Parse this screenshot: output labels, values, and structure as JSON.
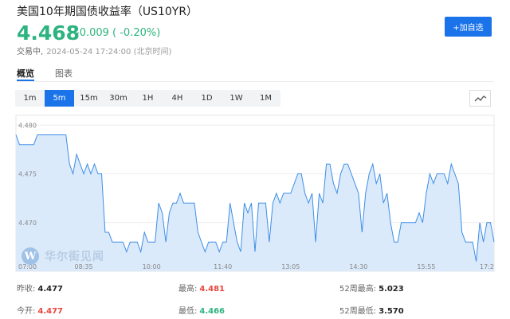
{
  "header": {
    "title": "美国10年期国债收益率（US10YR）",
    "price": "4.468",
    "change": "-0.009 ( -0.20%)",
    "status": "交易中,",
    "timestamp": "2024-05-24 17:24:00 (北京时间)",
    "add_label": "+加自选"
  },
  "view_tabs": [
    "概览",
    "图表"
  ],
  "intervals": [
    "1m",
    "5m",
    "15m",
    "30m",
    "1H",
    "4H",
    "1D",
    "1W",
    "1M"
  ],
  "active_interval": "5m",
  "watermark": "华尔街见闻",
  "chart_data": {
    "type": "area",
    "ylim": [
      4.465,
      4.481
    ],
    "y_ticks": [
      "4.480",
      "4.475",
      "4.470"
    ],
    "y_tick_values": [
      4.48,
      4.475,
      4.47
    ],
    "x_ticks": [
      "07:00",
      "08:35",
      "10:00",
      "11:40",
      "13:05",
      "14:30",
      "15:55",
      "17:2"
    ],
    "x_tick_index": [
      0,
      19,
      38,
      58,
      77,
      96,
      115,
      134
    ],
    "values": [
      4.479,
      4.478,
      4.478,
      4.478,
      4.478,
      4.478,
      4.479,
      4.479,
      4.479,
      4.479,
      4.479,
      4.479,
      4.479,
      4.479,
      4.479,
      4.476,
      4.475,
      4.477,
      4.476,
      4.475,
      4.476,
      4.475,
      4.476,
      4.475,
      4.475,
      4.469,
      4.469,
      4.468,
      4.468,
      4.468,
      4.468,
      4.467,
      4.468,
      4.468,
      4.468,
      4.467,
      4.469,
      4.468,
      4.468,
      4.468,
      4.472,
      4.471,
      4.468,
      4.471,
      4.472,
      4.472,
      4.473,
      4.472,
      4.472,
      4.472,
      4.472,
      4.469,
      4.468,
      4.467,
      4.468,
      4.468,
      4.468,
      4.467,
      4.468,
      4.468,
      4.472,
      4.47,
      4.468,
      4.467,
      4.472,
      4.471,
      4.472,
      4.467,
      4.472,
      4.472,
      4.472,
      4.468,
      4.472,
      4.473,
      4.472,
      4.473,
      4.473,
      4.473,
      4.474,
      4.475,
      4.475,
      4.473,
      4.472,
      4.473,
      4.468,
      4.473,
      4.472,
      4.476,
      4.476,
      4.474,
      4.473,
      4.475,
      4.476,
      4.476,
      4.475,
      4.474,
      4.473,
      4.469,
      4.473,
      4.475,
      4.476,
      4.474,
      4.475,
      4.472,
      4.473,
      4.47,
      4.468,
      4.468,
      4.47,
      4.47,
      4.47,
      4.47,
      4.47,
      4.471,
      4.47,
      4.473,
      4.475,
      4.474,
      4.475,
      4.475,
      4.475,
      4.474,
      4.476,
      4.475,
      4.474,
      4.469,
      4.468,
      4.468,
      4.468,
      4.466,
      4.47,
      4.468,
      4.47,
      4.47,
      4.468
    ]
  },
  "stats": {
    "prev_close_label": "昨收:",
    "prev_close": "4.477",
    "open_label": "今开:",
    "open": "4.477",
    "high_label": "最高:",
    "high": "4.481",
    "low_label": "最低:",
    "low": "4.466",
    "w52_high_label": "52周最高:",
    "w52_high": "5.023",
    "w52_low_label": "52周最低:",
    "w52_low": "3.570"
  },
  "colors": {
    "up": "#e8453c",
    "down": "#2db37f",
    "accent": "#1a73e8",
    "chart_line": "#3d8ee6",
    "chart_fill": "#dbeafb"
  }
}
